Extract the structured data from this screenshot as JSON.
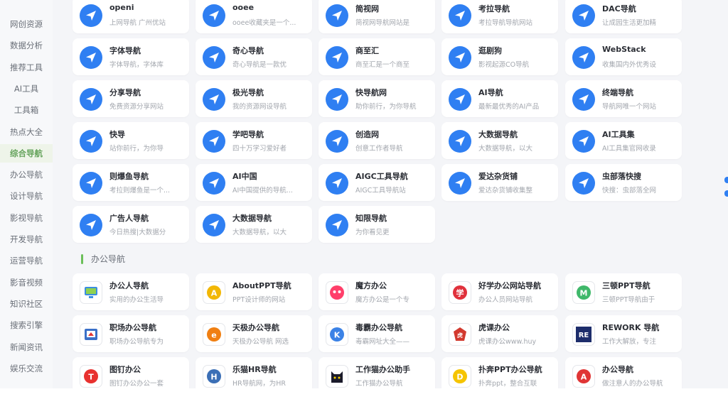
{
  "sidebar": {
    "items": [
      {
        "label": "网创资源"
      },
      {
        "label": "数据分析"
      },
      {
        "label": "推荐工具"
      },
      {
        "label": "AI工具"
      },
      {
        "label": "工具箱"
      },
      {
        "label": "热点大全"
      },
      {
        "label": "综合导航",
        "active": true
      },
      {
        "label": "办公导航"
      },
      {
        "label": "设计导航"
      },
      {
        "label": "影视导航"
      },
      {
        "label": "开发导航"
      },
      {
        "label": "运营导航"
      },
      {
        "label": "影音视频"
      },
      {
        "label": "知识社区"
      },
      {
        "label": "搜索引擎"
      },
      {
        "label": "新闻资讯"
      },
      {
        "label": "娱乐交流"
      }
    ]
  },
  "nav_cards": [
    {
      "title": "openi",
      "desc": "上网导航 广州优站"
    },
    {
      "title": "ooee",
      "desc": "ooee收藏夹是一个..."
    },
    {
      "title": "简视网",
      "desc": "简视网导航网站是"
    },
    {
      "title": "考拉导航",
      "desc": "考拉导航导航网站"
    },
    {
      "title": "DAC导航",
      "desc": "让成园生活更加精"
    },
    {
      "title": "字体导航",
      "desc": "字体导航，字体库"
    },
    {
      "title": "奇心导航",
      "desc": "奇心导航是一款优"
    },
    {
      "title": "商至汇",
      "desc": "商至汇是一个商至"
    },
    {
      "title": "逛剧狗",
      "desc": "影视起源CO导航"
    },
    {
      "title": "WebStack",
      "desc": "收集国内外优秀设"
    },
    {
      "title": "分享导航",
      "desc": "免费资源分享网站"
    },
    {
      "title": "极光导航",
      "desc": "我的资源网设导航"
    },
    {
      "title": "快导航网",
      "desc": "助你前行，为你导航"
    },
    {
      "title": "AI导航",
      "desc": "最新最优秀的AI产品"
    },
    {
      "title": "终端导航",
      "desc": "导航网唯一个网站"
    },
    {
      "title": "快导",
      "desc": "站你前行，为你导"
    },
    {
      "title": "学吧导航",
      "desc": "四十万学习爱好者"
    },
    {
      "title": "创造网",
      "desc": "创意工作者导航"
    },
    {
      "title": "大数据导航",
      "desc": "大数据导航，以大"
    },
    {
      "title": "AI工具集",
      "desc": "AI工具集官网收录"
    },
    {
      "title": "则爆鱼导航",
      "desc": "考拉则爆鱼是一个..."
    },
    {
      "title": "AI中国",
      "desc": "AI中国提供的导航..."
    },
    {
      "title": "AIGC工具导航",
      "desc": "AIGC工具导航站"
    },
    {
      "title": "爱达杂货铺",
      "desc": "爱达杂货铺收集整"
    },
    {
      "title": "虫部落快搜",
      "desc": "快搜：虫部落全网"
    },
    {
      "title": "广告人导航",
      "desc": "今日热搜|大数据分"
    },
    {
      "title": "大数据导航",
      "desc": "大数据导航，以大"
    },
    {
      "title": "知限导航",
      "desc": "为你看见更"
    }
  ],
  "section": {
    "title": "办公导航"
  },
  "office_cards": [
    {
      "title": "办公人导航",
      "desc": "实用的办公生活导",
      "icon": "monitor",
      "color": "#3a8de0"
    },
    {
      "title": "AboutPPT导航",
      "desc": "PPT设计师的网站",
      "icon": "A",
      "color": "#f2b705"
    },
    {
      "title": "魔方办公",
      "desc": "魔方办公是一个专",
      "icon": "face",
      "color": "#ff3f6a"
    },
    {
      "title": "好学办公网站导航",
      "desc": "办公人员网站导航",
      "icon": "学",
      "color": "#e0313c"
    },
    {
      "title": "三顿PPT导航",
      "desc": "三顿PPT导航由于",
      "icon": "M",
      "color": "#3fb86a"
    },
    {
      "title": "职场办公导航",
      "desc": "职场办公导航专为",
      "icon": "screen",
      "color": "#3a70c8"
    },
    {
      "title": "天极办公导航",
      "desc": "天极办公导航 网选",
      "icon": "e",
      "color": "#f07f12"
    },
    {
      "title": "毒霸办公导航",
      "desc": "毒霸网址大全——",
      "icon": "K",
      "color": "#3b82e6"
    },
    {
      "title": "虎课办公",
      "desc": "虎课办公www.huy",
      "icon": "seal",
      "color": "#d2392e"
    },
    {
      "title": "REWORK 导航",
      "desc": "工作大解放，专注",
      "icon": "RE",
      "color": "#1d2d6b"
    },
    {
      "title": "图钉办公",
      "desc": "图钉办公办公一套",
      "icon": "T",
      "color": "#e8312f"
    },
    {
      "title": "乐猫HR导航",
      "desc": "HR导航网，为HR",
      "icon": "H",
      "color": "#3b6fb6"
    },
    {
      "title": "工作猫办公助手",
      "desc": "工作猫办公导航",
      "icon": "cat",
      "color": "#1b1b2b"
    },
    {
      "title": "扑奔PPT办公导航",
      "desc": "扑奔ppt，整合互联",
      "icon": "D",
      "color": "#f5c400"
    },
    {
      "title": "办公导航",
      "desc": "做注意人的办公导航",
      "icon": "A",
      "color": "#e03535"
    }
  ]
}
